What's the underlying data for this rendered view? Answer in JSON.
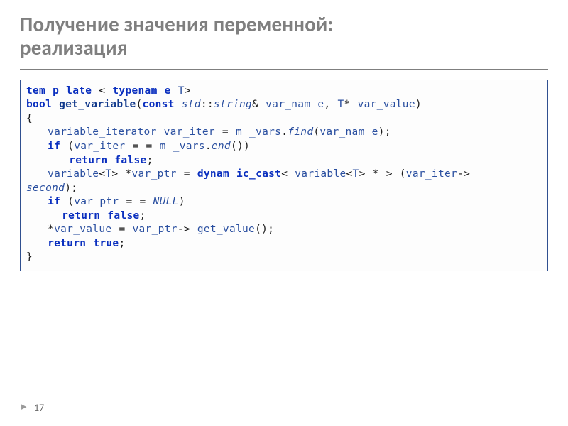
{
  "title_line1": "Получение значения переменной:",
  "title_line2": "реализация",
  "page_number": "17",
  "code": {
    "l1": {
      "kw1": "tem p late",
      "kw2": "typenam e",
      "t": "T"
    },
    "l2": {
      "kw_bool": "bool",
      "fn": "get_variable",
      "kw_const": "const",
      "std": "std",
      "string": "string",
      "amp": "&",
      "vn": "var_nam e",
      "t": "T",
      "star": "*",
      "vv": "var_value"
    },
    "l3": "{",
    "l4": {
      "vi_t": "variable_iterator",
      "vi": "var_iter",
      "eq": "=",
      "mv": "m _vars",
      "find": "find",
      "vn": "var_nam e"
    },
    "l5": {
      "kw_if": "if",
      "vi": "var_iter",
      "eqeq": "= =",
      "mv": "m _vars",
      "end": "end"
    },
    "l6": {
      "kw_ret": "return",
      "fal": "false"
    },
    "l7": {
      "var_t": "variable",
      "t1": "T",
      "vp": "var_ptr",
      "kw_dc": "dynam ic_cast",
      "var_t2": "variable",
      "t2": "T",
      "vi": "var_iter"
    },
    "l7b": {
      "sec": "second"
    },
    "l8": {
      "kw_if": "if",
      "vp": "var_ptr",
      "eqeq": "= =",
      "nul": "NULL"
    },
    "l9": {
      "kw_ret": "return",
      "fal": "false"
    },
    "l10": {
      "vv": "var_value",
      "eq": "=",
      "vp": "var_ptr",
      "gv": "get_value"
    },
    "l11": {
      "kw_ret": "return",
      "tru": "true"
    },
    "l12": "}"
  }
}
